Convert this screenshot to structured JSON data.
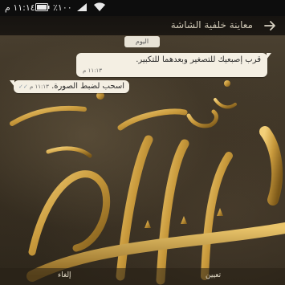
{
  "status_bar": {
    "time": "١١:١٤ م",
    "battery_percent": "٪١٠٠"
  },
  "header": {
    "title": "معاينة خلفية الشاشة"
  },
  "chat": {
    "date_chip": "اليوم",
    "messages": [
      {
        "text": "قرب إصبعيك للتصغير وبعدهما للتكبير.",
        "time": "١١:١٣ م",
        "direction": "incoming"
      },
      {
        "text": "اسحب لضبط الصورة.",
        "time": "١١:١٣ م",
        "ticks": "✓✓",
        "direction": "outgoing"
      }
    ]
  },
  "bottom_bar": {
    "cancel_label": "إلغاء",
    "set_label": "تعيين"
  },
  "colors": {
    "bubble": "#f4efe3",
    "header": "#1c1813",
    "gold": "#c99a3c"
  }
}
